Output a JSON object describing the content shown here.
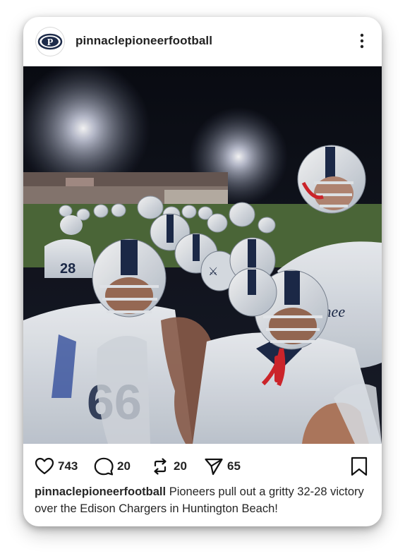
{
  "post": {
    "username": "pinnaclepioneerfootball",
    "avatar_letter": "P",
    "photo_icon": "football-team-celebration-photo",
    "more_icon": "more-vertical-icon"
  },
  "actions": {
    "likes": "743",
    "comments": "20",
    "reposts": "20",
    "shares": "65",
    "like_icon": "heart-icon",
    "comment_icon": "comment-icon",
    "repost_icon": "repost-icon",
    "share_icon": "send-icon",
    "save_icon": "bookmark-icon"
  },
  "caption": {
    "username": "pinnaclepioneerfootball",
    "text": "Pioneers pull out a gritty 32-28 victory over the Edison Chargers in Huntington Beach!"
  },
  "colors": {
    "text": "#222222",
    "jersey_white": "#e8ecf1",
    "helmet_navy": "#1d2b4a",
    "accent_red": "#d6262d"
  }
}
